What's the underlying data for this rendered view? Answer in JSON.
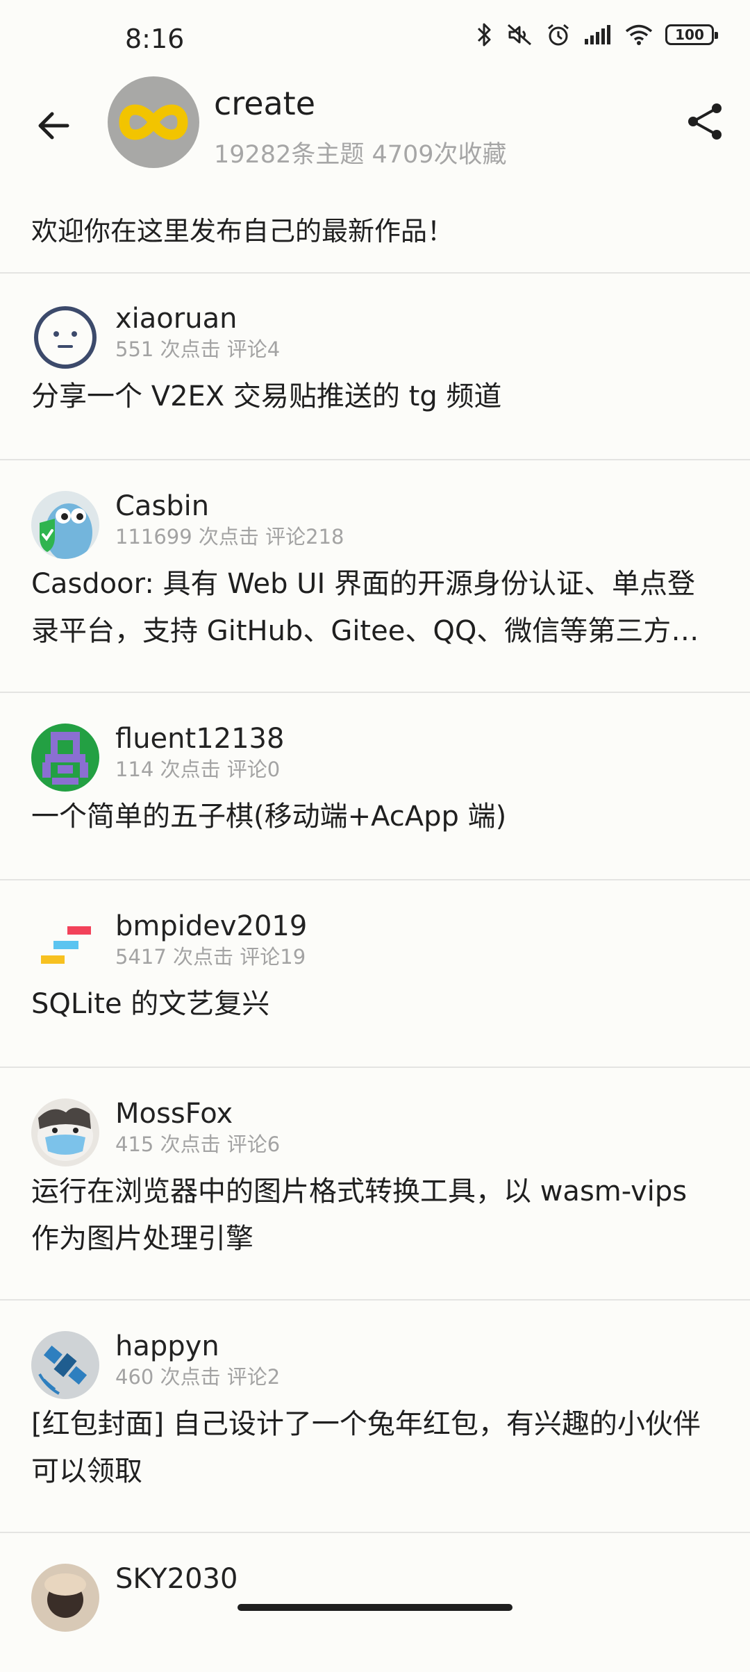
{
  "status_bar": {
    "time": "8:16",
    "battery": "100",
    "icons": [
      "bluetooth-icon",
      "mute-icon",
      "alarm-icon",
      "signal-icon",
      "wifi-icon",
      "battery-icon"
    ]
  },
  "header": {
    "node_name": "create",
    "node_meta": "19282条主题 4709次收藏",
    "icons": [
      "back-arrow-icon",
      "node-logo",
      "share-icon"
    ]
  },
  "intro": "欢迎你在这里发布自己的最新作品！",
  "topics": [
    {
      "user": "xiaoruan",
      "stats": "551 次点击  评论4",
      "title": "分享一个 V2EX 交易贴推送的 tg 频道"
    },
    {
      "user": "Casbin",
      "stats": "111699 次点击  评论218",
      "title": "Casdoor: 具有 Web UI 界面的开源身份认证、单点登录平台，支持 GitHub、Gitee、QQ、微信等第三方登录"
    },
    {
      "user": "fluent12138",
      "stats": "114 次点击  评论0",
      "title": "一个简单的五子棋(移动端+AcApp 端)"
    },
    {
      "user": "bmpidev2019",
      "stats": "5417 次点击  评论19",
      "title": "SQLite 的文艺复兴"
    },
    {
      "user": "MossFox",
      "stats": "415 次点击  评论6",
      "title": "运行在浏览器中的图片格式转换工具，以 wasm-vips 作为图片处理引擎"
    },
    {
      "user": "happyn",
      "stats": "460 次点击  评论2",
      "title": "[红包封面] 自己设计了一个兔年红包，有兴趣的小伙伴可以领取"
    },
    {
      "user": "SKY2030",
      "stats": "",
      "title": ""
    }
  ],
  "colors": {
    "background": "#fcfcf9",
    "text_primary": "#1f1f1f",
    "text_secondary": "#a3a3a3",
    "divider": "#e4e4e2",
    "node_logo": "#f2c400"
  }
}
